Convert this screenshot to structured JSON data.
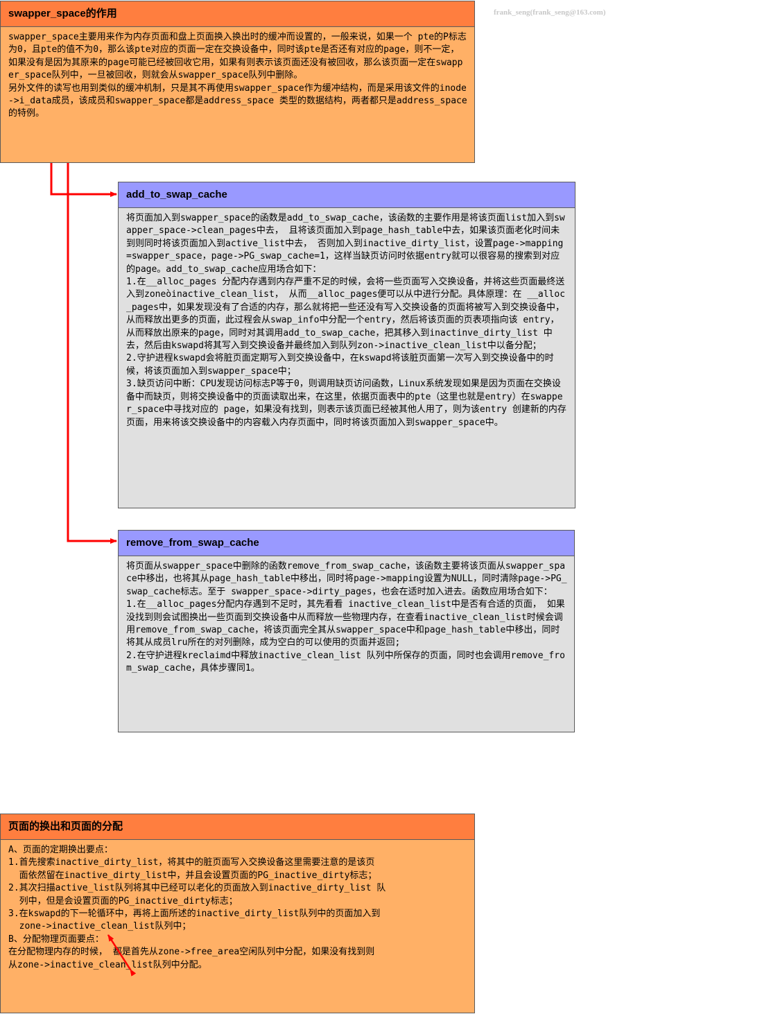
{
  "watermark": "frank_seng(frank_seng@163.com)",
  "boxes": {
    "swapper_space": {
      "title": "swapper_space的作用",
      "body": "swapper_space主要用来作为内存页面和盘上页面换入换出时的缓冲而设置的，一般来说，如果一个 pte的P标志为0，且pte的值不为0，那么该pte对应的页面一定在交换设备中，同时该pte是否还有对应的page，则不一定，如果没有是因为其原来的page可能已经被回收它用，如果有则表示该页面还没有被回收，那么该页面一定在swapper_space队列中，一旦被回收，则就会从swapper_space队列中删除。\n另外文件的读写也用到类似的缓冲机制，只是其不再使用swapper_space作为缓冲结构，而是采用该文件的inode->i_data成员，该成员和swapper_space都是address_space 类型的数据结构，两者都只是address_space的特例。"
    },
    "add_to_swap_cache": {
      "title": "add_to_swap_cache",
      "body": "将页面加入到swapper_space的函数是add_to_swap_cache，该函数的主要作用是将该页面list加入到swapper_space->clean_pages中去， 且将该页面加入到page_hash_table中去，如果该页面老化时间未到则同时将该页面加入到active_list中去， 否则加入到inactive_dirty_list，设置page->mapping=swapper_space，page->PG_swap_cache=1，这样当缺页访问时依据entry就可以很容易的搜索到对应的page。add_to_swap_cache应用场合如下：\n1.在__alloc_pages 分配内存遇到内存严重不足的时候，会将一些页面写入交换设备，并将这些页面最终送入到zoneòinactive_clean_list， 从而__alloc_pages便可以从中进行分配。具体原理：在 __alloc_pages中，如果发现没有了合适的内存，那么就将把一些还没有写入交换设备的页面将被写入到交换设备中，从而释放出更多的页面，此过程会从swap_info中分配一个entry，然后将该页面的页表项指向该 entry，从而释放出原来的page，同时对其调用add_to_swap_cache，把其移入到inactinve_dirty_list 中去，然后由kswapd将其写入到交换设备并最终加入到队列zon->inactive_clean_list中以备分配；\n2.守护进程kswapd会将脏页面定期写入到交换设备中，在kswapd将该脏页面第一次写入到交换设备中的时候，将该页面加入到swapper_space中；\n3.缺页访问中断：CPU发现访问标志P等于0，则调用缺页访问函数，Linux系统发现如果是因为页面在交换设备中而缺页，则将交换设备中的页面读取出来，在这里，依据页面表中的pte（这里也就是entry）在swapper_space中寻找对应的 page，如果没有找到，则表示该页面已经被其他人用了，则为该entry 创建新的内存页面，用来将该交换设备中的内容载入内存页面中，同时将该页面加入到swapper_space中。"
    },
    "remove_from_swap_cache": {
      "title": "remove_from_swap_cache",
      "body": "将页面从swapper_space中删除的函数remove_from_swap_cache，该函数主要将该页面从swapper_space中移出，也将其从page_hash_table中移出，同时将page->mapping设置为NULL，同时清除page->PG_swap_cache标志。至于 swapper_space->dirty_pages，也会在适时加入进去。函数应用场合如下：\n1.在__alloc_pages分配内存遇到不足时，其先看看 inactive_clean_list中是否有合适的页面， 如果没找到则会试图换出一些页面到交换设备中从而释放一些物理内存，在查看inactive_clean_list时候会调用remove_from_swap_cache，将该页面完全其从swapper_space中和page_hash_table中移出，同时将其从成员lru所在的对列删除，成为空白的可以使用的页面并返回;\n2.在守护进程kreclaimd中释放inactive_clean_list 队列中所保存的页面，同时也会调用remove_from_swap_cache，具体步骤同1。"
    },
    "paging": {
      "title": "页面的换出和页面的分配",
      "body": "A、页面的定期换出要点：\n1.首先搜索inactive_dirty_list，将其中的脏页面写入交换设备这里需要注意的是该页\n  面依然留在inactive_dirty_list中，并且会设置页面的PG_inactive_dirty标志；\n2.其次扫描active_list队列将其中已经可以老化的页面放入到inactive_dirty_list 队\n  列中，但是会设置页面的PG_inactive_dirty标志；\n3.在kswapd的下一轮循环中，再将上面所述的inactive_dirty_list队列中的页面加入到\n  zone->inactive_clean_list队列中；\nB、分配物理页面要点：\n在分配物理内存的时候， 都是首先从zone->free_area空闲队列中分配，如果没有找到则\n从zone->inactive_clean_list队列中分配。"
    }
  },
  "colors": {
    "orange_body": "#ffb066",
    "orange_header": "#ff7e3f",
    "gray_body": "#e0e0e0",
    "blue_header": "#9999ff",
    "connector": "#ff0000"
  }
}
